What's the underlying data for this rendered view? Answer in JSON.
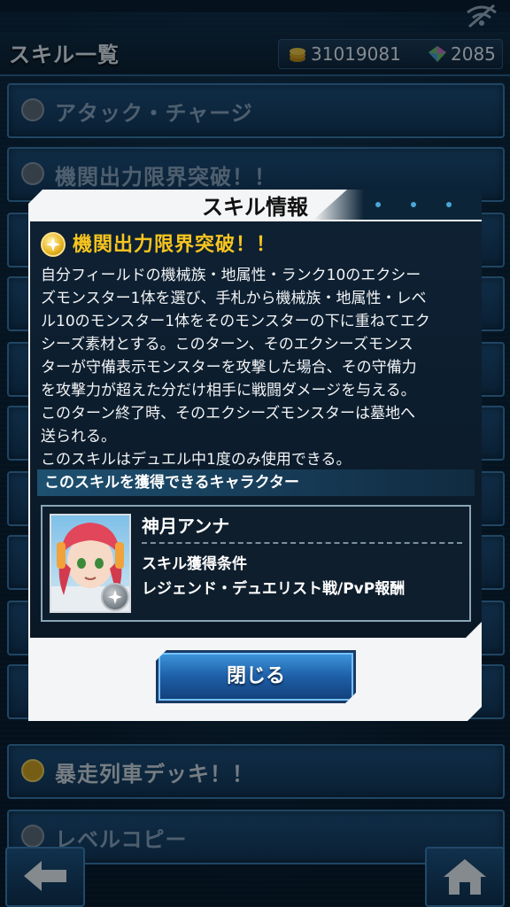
{
  "header": {
    "title": "スキル一覧",
    "gold": "31019081",
    "gems": "2085"
  },
  "list": {
    "items": [
      {
        "label": "アタック・チャージ"
      },
      {
        "label": "機関出力限界突破！！"
      },
      {
        "label": "暴走列車デッキ！！"
      },
      {
        "label": "レベルコピー"
      }
    ]
  },
  "dialog": {
    "title": "スキル情報",
    "skill_name": "機関出力限界突破！！",
    "description": "自分フィールドの機械族・地属性・ランク10のエクシー\nズモンスター1体を選び、手札から機械族・地属性・レベ\nル10のモンスター1体をそのモンスターの下に重ねてエク\nシーズ素材とする。このターン、そのエクシーズモンス\nターが守備表示モンスターを攻撃した場合、その守備力\nを攻撃力が超えた分だけ相手に戦闘ダメージを与える。\nこのターン終了時、そのエクシーズモンスターは墓地へ\n送られる。\nこのスキルはデュエル中1度のみ使用できる。",
    "section_header": "このスキルを獲得できるキャラクター",
    "character": {
      "name": "神月アンナ",
      "condition_label": "スキル獲得条件",
      "condition_value": "レジェンド・デュエリスト戦/PvP報酬"
    },
    "close_label": "閉じる"
  },
  "colors": {
    "skill_name": "#f7c51f",
    "button_blue": "#1d5fa8",
    "panel_dark": "#0e2133"
  },
  "icons": [
    "wifi-off-icon",
    "coin-icon",
    "gem-icon",
    "skill-star-icon",
    "back-arrow-icon",
    "home-icon"
  ]
}
